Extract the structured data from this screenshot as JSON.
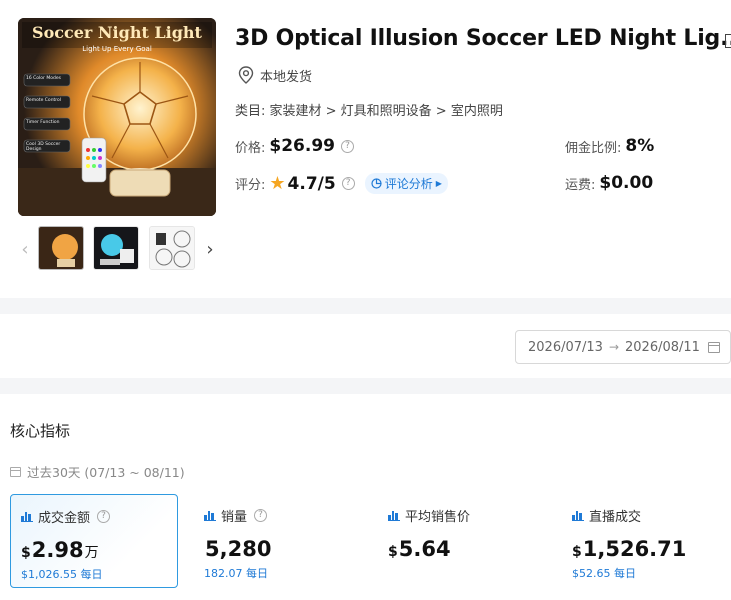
{
  "product": {
    "title": "3D Optical Illusion Soccer LED Night Lig...",
    "location": "本地发货",
    "category": "类目: 家装建材 > 灯具和照明设备 > 室内照明",
    "image_texts": {
      "headline": "Soccer Night Light",
      "tagline": "Light Up Every Goal",
      "features": [
        "16 Color Modes",
        "Remote Control",
        "Timer Function",
        "Cool 3D Soccer Design"
      ]
    }
  },
  "info": {
    "price_label": "价格:",
    "price_value": "$26.99",
    "commission_label": "佣金比例:",
    "commission_value": "8%",
    "rating_label": "评分:",
    "rating_value": "4.7/5",
    "review_tag": "评论分析",
    "shipping_label": "运费:",
    "shipping_value": "$0.00"
  },
  "date_range": {
    "start": "2026/07/13",
    "end": "2026/08/11"
  },
  "core": {
    "title": "核心指标",
    "period": "过去30天 (07/13 ~ 08/11)",
    "metrics": [
      {
        "label": "成交金额",
        "currency": "$",
        "value": "2.98",
        "unit": "万",
        "sub": "$1,026.55 每日",
        "has_help": true,
        "active": true
      },
      {
        "label": "销量",
        "currency": "",
        "value": "5,280",
        "unit": "",
        "sub": "182.07 每日",
        "has_help": true,
        "active": false
      },
      {
        "label": "平均销售价",
        "currency": "$",
        "value": "5.64",
        "unit": "",
        "sub": "",
        "has_help": false,
        "active": false
      },
      {
        "label": "直播成交",
        "currency": "$",
        "value": "1,526.71",
        "unit": "",
        "sub": "$52.65 每日",
        "has_help": false,
        "active": false
      }
    ]
  },
  "colors": {
    "accent": "#1f7ad6",
    "star": "#f5a623",
    "active_border": "#2f9ae0"
  }
}
